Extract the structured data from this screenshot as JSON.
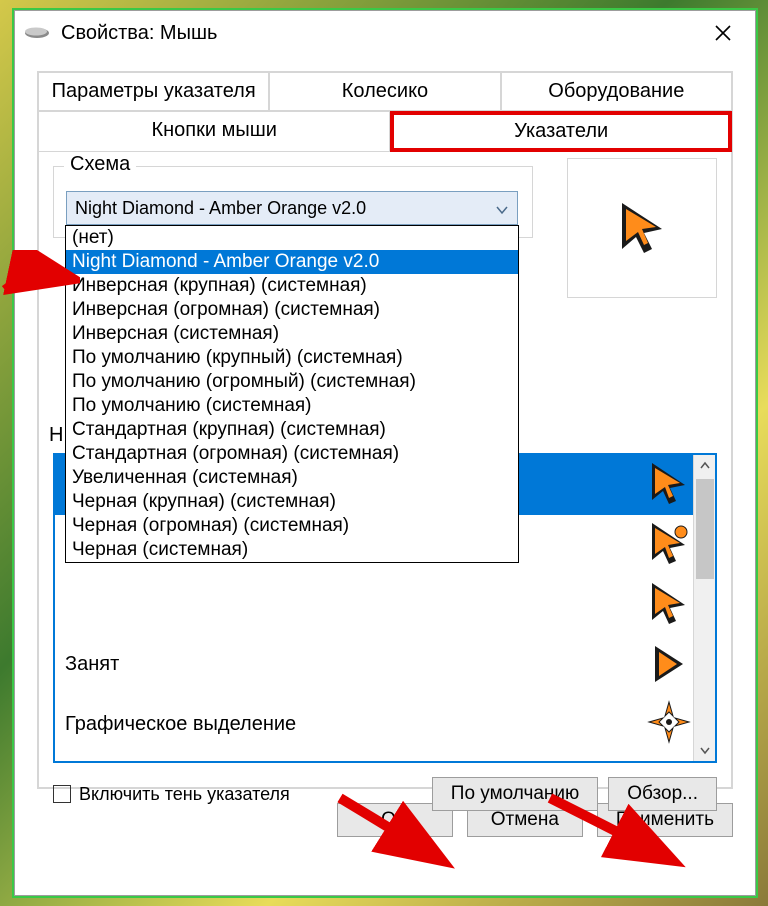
{
  "window": {
    "title": "Свойства: Мышь"
  },
  "tabs": {
    "row1": [
      "Параметры указателя",
      "Колесико",
      "Оборудование"
    ],
    "row2": [
      "Кнопки мыши",
      "Указатели"
    ]
  },
  "scheme": {
    "legend": "Схема",
    "selected": "Night Diamond - Amber Orange v2.0",
    "options": [
      "(нет)",
      "Night Diamond - Amber Orange v2.0",
      "Инверсная (крупная) (системная)",
      "Инверсная (огромная) (системная)",
      "Инверсная (системная)",
      "По умолчанию (крупный) (системная)",
      "По умолчанию (огромный) (системная)",
      "По умолчанию (системная)",
      "Стандартная (крупная) (системная)",
      "Стандартная (огромная) (системная)",
      "Увеличенная (системная)",
      "Черная (крупная) (системная)",
      "Черная (огромная) (системная)",
      "Черная (системная)"
    ]
  },
  "customize": {
    "partial_label": "Н",
    "rows": [
      {
        "label": "",
        "selected": true
      },
      {
        "label": ""
      },
      {
        "label": ""
      },
      {
        "label": "Занят"
      },
      {
        "label": "Графическое выделение"
      }
    ]
  },
  "shadow_checkbox": "Включить тень указателя",
  "buttons": {
    "defaults": "По умолчанию",
    "browse": "Обзор...",
    "ok": "OK",
    "cancel": "Отмена",
    "apply": "Применить"
  }
}
